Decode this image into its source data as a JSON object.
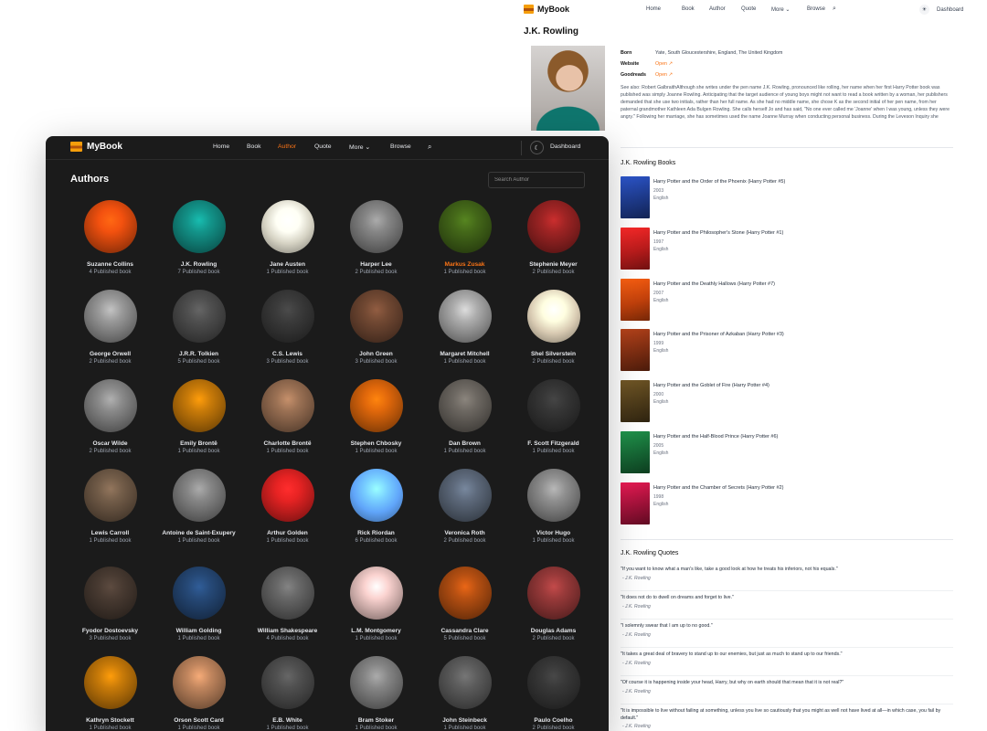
{
  "light": {
    "nav": {
      "brand": "MyBook",
      "links": [
        "Home",
        "Book",
        "Author",
        "Quote",
        "More",
        "Browse"
      ],
      "dashboard": "Dashboard"
    },
    "author_name": "J.K. Rowling",
    "meta": {
      "born_label": "Born",
      "born_value": "Yate, South Gloucestershire, England, The United Kingdom",
      "website_label": "Website",
      "website_value": "Open",
      "goodreads_label": "Goodreads",
      "goodreads_value": "Open"
    },
    "bio": "See also: Robert GalbraithAlthough she writes under the pen name J.K. Rowling, pronounced like rolling, her name when her first Harry Potter book was published was simply Joanne Rowling. Anticipating that the target audience of young boys might not want to read a book written by a woman, her publishers demanded that she use two initials, rather than her full name. As she had no middle name, she chose K as the second initial of her pen name, from her paternal grandmother Kathleen Ada Bulgen Rowling. She calls herself Jo and has said, \"No one ever called me 'Joanne' when I was young, unless they were angry.\" Following her marriage, she has sometimes used the name Joanne Murray when conducting personal business. During the Leveson Inquiry she",
    "books_title": "J.K. Rowling Books",
    "books": [
      {
        "title": "Harry Potter and the Order of the Phoenix (Harry Potter #5)",
        "year": "2003",
        "language": "English",
        "color": "#1e3a8a"
      },
      {
        "title": "Harry Potter and the Philosopher's Stone (Harry Potter #1)",
        "year": "1997",
        "language": "English",
        "color": "#b91c1c"
      },
      {
        "title": "Harry Potter and the Deathly Hallows (Harry Potter #7)",
        "year": "2007",
        "language": "English",
        "color": "#c2410c"
      },
      {
        "title": "Harry Potter and the Prisoner of Azkaban (Harry Potter #3)",
        "year": "1999",
        "language": "English",
        "color": "#7c2d12"
      },
      {
        "title": "Harry Potter and the Goblet of Fire (Harry Potter #4)",
        "year": "2000",
        "language": "English",
        "color": "#4d3b1a"
      },
      {
        "title": "Harry Potter and the Half-Blood Prince (Harry Potter #6)",
        "year": "2005",
        "language": "English",
        "color": "#166534"
      },
      {
        "title": "Harry Potter and the Chamber of Secrets (Harry Potter #2)",
        "year": "1998",
        "language": "English",
        "color": "#9f1239"
      }
    ],
    "quotes_title": "J.K. Rowling Quotes",
    "quotes": [
      {
        "text": "\"If you want to know what a man's like, take a good look at how he treats his inferiors, not his equals.\"",
        "author": "- J.K. Rowling"
      },
      {
        "text": "\"It does not do to dwell on dreams and forget to live.\"",
        "author": "- J.K. Rowling"
      },
      {
        "text": "\"I solemnly swear that I am up to no good.\"",
        "author": "- J.K. Rowling"
      },
      {
        "text": "\"It takes a great deal of bravery to stand up to our enemies, but just as much to stand up to our friends.\"",
        "author": "- J.K. Rowling"
      },
      {
        "text": "\"Of course it is happening inside your head, Harry, but why on earth should that mean that it is not real?\"",
        "author": "- J.K. Rowling"
      },
      {
        "text": "\"It is impossible to live without failing at something, unless you live so cautiously that you might as well not have lived at all—in which case, you fail by default.\"",
        "author": "- J.K. Rowling"
      }
    ]
  },
  "dark": {
    "nav": {
      "brand": "MyBook",
      "home": "Home",
      "book": "Book",
      "author": "Author",
      "quote": "Quote",
      "more": "More",
      "browse": "Browse",
      "dashboard": "Dashboard"
    },
    "title": "Authors",
    "search_placeholder": "Search Author",
    "authors": [
      {
        "name": "Suzanne Collins",
        "count": "4 Published book",
        "color": "#c2410c"
      },
      {
        "name": "J.K. Rowling",
        "count": "7 Published book",
        "color": "#0f766e"
      },
      {
        "name": "Jane Austen",
        "count": "1 Published book",
        "color": "#d6d3c4"
      },
      {
        "name": "Harper Lee",
        "count": "2 Published book",
        "color": "#6b6b6b"
      },
      {
        "name": "Markus Zusak",
        "count": "1 Published book",
        "color": "#365314",
        "highlight": true
      },
      {
        "name": "Stephenie Meyer",
        "count": "2 Published book",
        "color": "#7f1d1d"
      },
      {
        "name": "George Orwell",
        "count": "2 Published book",
        "color": "#7a7a7a"
      },
      {
        "name": "J.R.R. Tolkien",
        "count": "5 Published book",
        "color": "#3f3f3f"
      },
      {
        "name": "C.S. Lewis",
        "count": "3 Published book",
        "color": "#2f2f2f"
      },
      {
        "name": "John Green",
        "count": "3 Published book",
        "color": "#5b3a29"
      },
      {
        "name": "Margaret Mitchell",
        "count": "1 Published book",
        "color": "#8a8a8a"
      },
      {
        "name": "Shel Silverstein",
        "count": "2 Published book",
        "color": "#d9cbb3"
      },
      {
        "name": "Oscar Wilde",
        "count": "2 Published book",
        "color": "#6e6e6e"
      },
      {
        "name": "Emily Brontë",
        "count": "1 Published book",
        "color": "#a16207"
      },
      {
        "name": "Charlotte Brontë",
        "count": "1 Published book",
        "color": "#7c5a43"
      },
      {
        "name": "Stephen Chbosky",
        "count": "1 Published book",
        "color": "#b45309"
      },
      {
        "name": "Dan Brown",
        "count": "1 Published book",
        "color": "#57534e"
      },
      {
        "name": "F. Scott Fitzgerald",
        "count": "1 Published book",
        "color": "#2b2b2b"
      },
      {
        "name": "Lewis Carroll",
        "count": "1 Published book",
        "color": "#5c4a3a"
      },
      {
        "name": "Antoine de Saint-Exupery",
        "count": "1 Published book",
        "color": "#6b6b6b"
      },
      {
        "name": "Arthur Golden",
        "count": "1 Published book",
        "color": "#b91c1c"
      },
      {
        "name": "Rick Riordan",
        "count": "6 Published book",
        "color": "#60a5fa"
      },
      {
        "name": "Veronica Roth",
        "count": "2 Published book",
        "color": "#4b5563"
      },
      {
        "name": "Victor Hugo",
        "count": "1 Published book",
        "color": "#737373"
      },
      {
        "name": "Fyodor Dostoevsky",
        "count": "3 Published book",
        "color": "#3a2f28"
      },
      {
        "name": "William Golding",
        "count": "1 Published book",
        "color": "#1e3a5f"
      },
      {
        "name": "William Shakespeare",
        "count": "4 Published book",
        "color": "#525252"
      },
      {
        "name": "L.M. Montgomery",
        "count": "1 Published book",
        "color": "#c9a9a6"
      },
      {
        "name": "Cassandra Clare",
        "count": "5 Published book",
        "color": "#92400e"
      },
      {
        "name": "Douglas Adams",
        "count": "2 Published book",
        "color": "#7a2e2e"
      },
      {
        "name": "Kathryn Stockett",
        "count": "1 Published book",
        "color": "#a16207"
      },
      {
        "name": "Orson Scott Card",
        "count": "1 Published book",
        "color": "#9a6b4b"
      },
      {
        "name": "E.B. White",
        "count": "1 Published book",
        "color": "#404040"
      },
      {
        "name": "Bram Stoker",
        "count": "1 Published book",
        "color": "#6b6b6b"
      },
      {
        "name": "John Steinbeck",
        "count": "1 Published book",
        "color": "#4a4a4a"
      },
      {
        "name": "Paulo Coelho",
        "count": "2 Published book",
        "color": "#2d2d2d"
      }
    ]
  }
}
